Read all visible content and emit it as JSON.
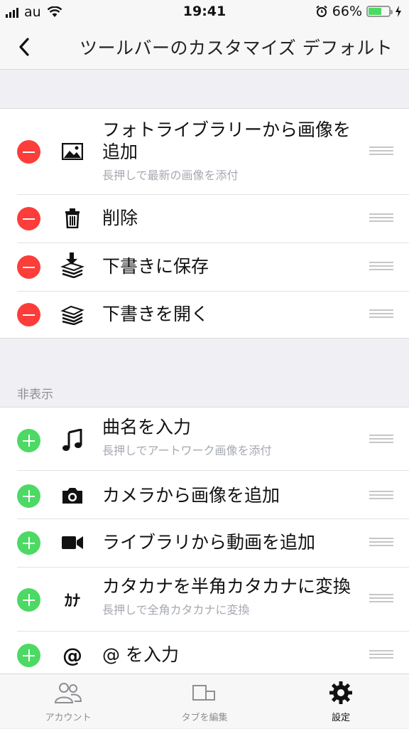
{
  "status_bar": {
    "carrier": "au",
    "time": "19:41",
    "battery": "66%",
    "battery_level": 0.66
  },
  "nav": {
    "title": "ツールバーのカスタマイズ デフォルト"
  },
  "visible_section": {
    "items": [
      {
        "label": "フォトライブラリーから画像を追加",
        "sub": "長押しで最新の画像を添付",
        "icon": "image-icon",
        "action": "remove"
      },
      {
        "label": "削除",
        "sub": "",
        "icon": "trash-icon",
        "action": "remove"
      },
      {
        "label": "下書きに保存",
        "sub": "",
        "icon": "save-draft-icon",
        "action": "remove"
      },
      {
        "label": "下書きを開く",
        "sub": "",
        "icon": "open-draft-icon",
        "action": "remove"
      }
    ]
  },
  "hidden_section": {
    "header": "非表示",
    "items": [
      {
        "label": "曲名を入力",
        "sub": "長押しでアートワーク画像を添付",
        "icon": "music-note-icon",
        "action": "add"
      },
      {
        "label": "カメラから画像を追加",
        "sub": "",
        "icon": "camera-icon",
        "action": "add"
      },
      {
        "label": "ライブラリから動画を追加",
        "sub": "",
        "icon": "video-camera-icon",
        "action": "add"
      },
      {
        "label": "カタカナを半角カタカナに変換",
        "sub": "長押しで全角カタカナに変換",
        "icon": "katakana-icon",
        "glyph": "ｶﾅ",
        "action": "add"
      },
      {
        "label": "@ を入力",
        "sub": "",
        "icon": "at-sign-icon",
        "glyph": "@",
        "action": "add"
      }
    ]
  },
  "tab_bar": {
    "tabs": [
      {
        "label": "アカウント",
        "icon": "accounts-icon",
        "active": false
      },
      {
        "label": "タブを編集",
        "icon": "edit-tabs-icon",
        "active": false
      },
      {
        "label": "設定",
        "icon": "gear-icon",
        "active": true
      }
    ]
  },
  "colors": {
    "remove": "#fc3d39",
    "add": "#4cd964",
    "subtext": "#a5a9b1",
    "background": "#efeff4"
  }
}
